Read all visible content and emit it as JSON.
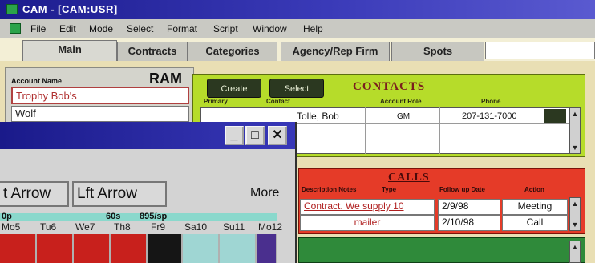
{
  "window": {
    "title": "CAM - [CAM:USR]"
  },
  "menu": [
    "File",
    "Edit",
    "Mode",
    "Select",
    "Format",
    "Script",
    "Window",
    "Help"
  ],
  "tabs": [
    "Main",
    "Contracts",
    "Categories",
    "Agency/Rep Firm",
    "Spots"
  ],
  "account": {
    "label": "Account Name",
    "badge": "RAM",
    "name": "Trophy Bob's",
    "name2": "Wolf"
  },
  "contacts": {
    "buttons": [
      "Create",
      "Select"
    ],
    "title": "CONTACTS",
    "headers": [
      "Primary",
      "Contact",
      "Account Role",
      "Phone"
    ],
    "rows": [
      {
        "contact": "Tolle, Bob",
        "role": "GM",
        "phone": "207-131-7000"
      }
    ]
  },
  "calls": {
    "title": "CALLS",
    "headers": [
      "Description Notes",
      "Type",
      "Follow up Date",
      "Action"
    ],
    "rows": [
      {
        "desc": "Contract. We supply 10",
        "date": "2/9/98",
        "action": "Meeting"
      },
      {
        "desc": "mailer",
        "date": "2/10/98",
        "action": "Call"
      }
    ]
  },
  "popup": {
    "controls": {
      "minimize": "_",
      "maximize": "□",
      "close": "✕"
    },
    "nav": [
      "t Arrow",
      "Lft Arrow"
    ],
    "more": "More",
    "top_labels": [
      "0p",
      "60s",
      "895/sp"
    ],
    "days": [
      "Mo5",
      "Tu6",
      "We7",
      "Th8",
      "Fr9",
      "Sa10",
      "Su11",
      "Mo12"
    ]
  },
  "colors": {
    "title_bar": "#1c1c8e",
    "contacts_panel": "#b6dc2a",
    "calls_panel": "#e53b28",
    "green_band": "#2f8a3a",
    "day_red": "#c8201c",
    "day_black": "#151515",
    "day_teal": "#9fd6d3",
    "day_purple": "#4a2f8e"
  }
}
